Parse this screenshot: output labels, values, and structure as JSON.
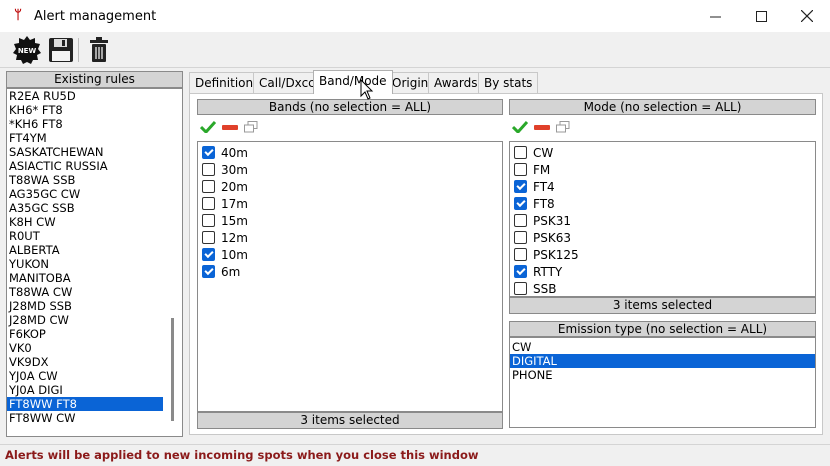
{
  "window": {
    "title": "Alert management"
  },
  "toolbar": {
    "new_label": "NEW"
  },
  "left": {
    "header": "Existing rules",
    "rules": [
      "R2EA RU5D",
      "KH6* FT8",
      "*KH6 FT8",
      "FT4YM",
      "SASKATCHEWAN",
      "ASIACTIC RUSSIA",
      "T88WA SSB",
      "AG35GC CW",
      "A35GC SSB",
      "K8H CW",
      "R0UT",
      "ALBERTA",
      "YUKON",
      "MANITOBA",
      "T88WA CW",
      "J28MD SSB",
      "J28MD CW",
      "F6KOP",
      "VK0",
      "VK9DX",
      "YJ0A CW",
      "YJ0A DIGI",
      "FT8WW FT8",
      "FT8WW CW"
    ],
    "selected_index": 22
  },
  "tabs": [
    "Definition",
    "Call/Dxcc",
    "Band/Mode",
    "Origin",
    "Awards",
    "By stats"
  ],
  "active_tab": "Band/Mode",
  "bands": {
    "header": "Bands (no selection = ALL)",
    "items": [
      {
        "label": "40m",
        "checked": true
      },
      {
        "label": "30m",
        "checked": false
      },
      {
        "label": "20m",
        "checked": false
      },
      {
        "label": "17m",
        "checked": false
      },
      {
        "label": "15m",
        "checked": false
      },
      {
        "label": "12m",
        "checked": false
      },
      {
        "label": "10m",
        "checked": true
      },
      {
        "label": "6m",
        "checked": true
      }
    ],
    "footer": "3 items selected"
  },
  "modes": {
    "header": "Mode (no selection = ALL)",
    "items": [
      {
        "label": "CW",
        "checked": false
      },
      {
        "label": "FM",
        "checked": false
      },
      {
        "label": "FT4",
        "checked": true
      },
      {
        "label": "FT8",
        "checked": true
      },
      {
        "label": "PSK31",
        "checked": false
      },
      {
        "label": "PSK63",
        "checked": false
      },
      {
        "label": "PSK125",
        "checked": false
      },
      {
        "label": "RTTY",
        "checked": true
      },
      {
        "label": "SSB",
        "checked": false
      }
    ],
    "footer": "3 items selected"
  },
  "emission": {
    "header": "Emission type (no selection = ALL)",
    "items": [
      "CW",
      "DIGITAL",
      "PHONE"
    ],
    "selected_index": 1
  },
  "status": "Alerts will be applied to new incoming spots when you close this window",
  "colors": {
    "selection": "#0a64d6",
    "header_bg": "#d4d4d4",
    "status_text": "#8b1a1a",
    "check_green": "#2aa82a",
    "minus_red": "#e0402a"
  }
}
